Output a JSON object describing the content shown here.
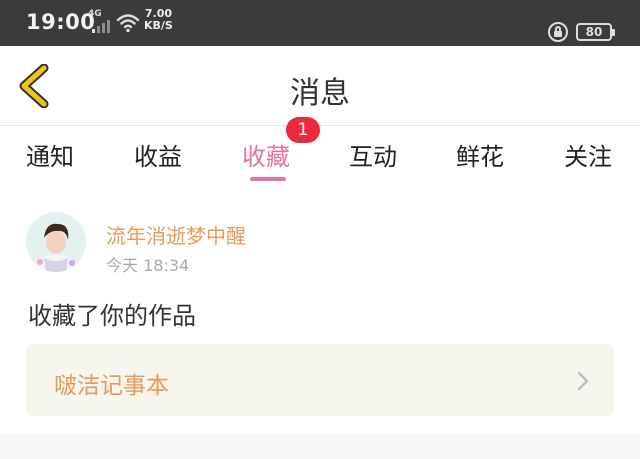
{
  "status_bar": {
    "time": "19:00",
    "network": "4G",
    "speed_value": "7.00",
    "speed_unit": "KB/S",
    "battery": "80"
  },
  "header": {
    "title": "消息",
    "back_icon": "chevron-left-icon",
    "accent_color": "#f0c419"
  },
  "tabs": {
    "items": [
      {
        "label": "通知"
      },
      {
        "label": "收益"
      },
      {
        "label": "收藏"
      },
      {
        "label": "互动"
      },
      {
        "label": "鲜花"
      },
      {
        "label": "关注"
      }
    ],
    "active_index": 2,
    "badge_count": "1",
    "active_color": "#e8739d",
    "badge_color": "#ec2a3b"
  },
  "message": {
    "username": "流年消逝梦中醒",
    "time": "今天 18:34",
    "action": "收藏了你的作品",
    "work_title": "啵洁记事本",
    "link_color": "#e89a5c"
  }
}
